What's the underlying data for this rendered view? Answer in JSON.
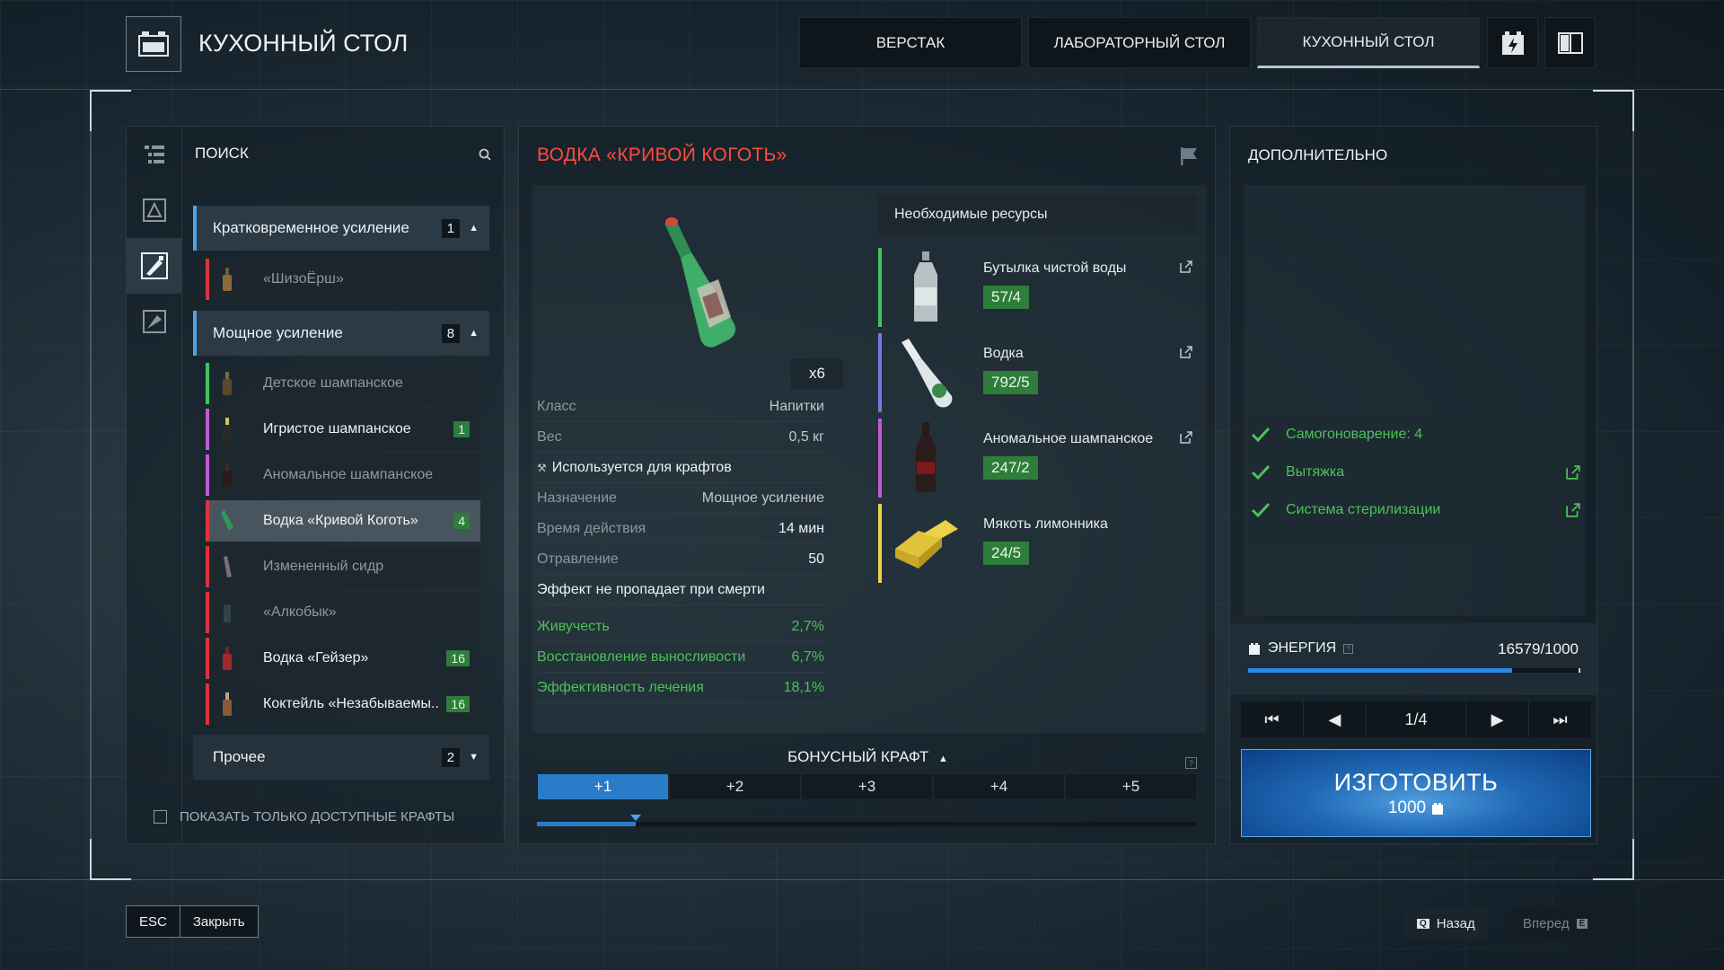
{
  "header": {
    "title": "КУХОННЫЙ СТОЛ",
    "tabs": [
      {
        "label": "ВЕРСТАК"
      },
      {
        "label": "ЛАБОРАТОРНЫЙ СТОЛ"
      },
      {
        "label": "КУХОННЫЙ СТОЛ"
      }
    ],
    "active_tab": 2
  },
  "left": {
    "search_label": "ПОИСК",
    "categories": [
      {
        "label": "Кратковременное усиление",
        "count": "1"
      },
      {
        "label": "Мощное усиление",
        "count": "8"
      },
      {
        "label": "Прочее",
        "count": "2"
      }
    ],
    "items": [
      {
        "label": "«ШизоЁрш»",
        "color": "#d9353d",
        "badge": ""
      },
      {
        "label": "Детское шампанское",
        "color": "#3fc460",
        "badge": ""
      },
      {
        "label": "Игристое шампанское",
        "color": "#c359d4",
        "badge": "1"
      },
      {
        "label": "Аномальное шампанское",
        "color": "#c359d4",
        "badge": ""
      },
      {
        "label": "Водка «Кривой Коготь»",
        "color": "#d9353d",
        "badge": "4"
      },
      {
        "label": "Измененный сидр",
        "color": "#d9353d",
        "badge": ""
      },
      {
        "label": "«Алкобык»",
        "color": "#d9353d",
        "badge": ""
      },
      {
        "label": "Водка «Гейзер»",
        "color": "#d9353d",
        "badge": "16"
      },
      {
        "label": "Коктейль «Незабываемы..",
        "color": "#d9353d",
        "badge": "16"
      }
    ],
    "show_available": "ПОКАЗАТЬ ТОЛЬКО ДОСТУПНЫЕ КРАФТЫ"
  },
  "recipe": {
    "title": "ВОДКА «КРИВОЙ КОГОТЬ»",
    "quantity": "x6",
    "stats": [
      {
        "k": "Класс",
        "v": "Напитки"
      },
      {
        "k": "Вес",
        "v": "0,5 кг"
      }
    ],
    "used_for": "Используется для крафтов",
    "details": [
      {
        "k": "Назначение",
        "v": "Мощное усиление"
      },
      {
        "k": "Время действия",
        "v": "14 мин"
      },
      {
        "k": "Отравление",
        "v": "50"
      }
    ],
    "no_death_loss": "Эффект не пропадает при смерти",
    "effects": [
      {
        "k": "Живучесть",
        "v": "2,7%"
      },
      {
        "k": "Восстановление выносливости",
        "v": "6,7%"
      },
      {
        "k": "Эффективность лечения",
        "v": "18,1%"
      }
    ],
    "resources_title": "Необходимые ресурсы",
    "resources": [
      {
        "name": "Бутылка чистой воды",
        "qty": "57/4",
        "color": "#3fc460",
        "link": true
      },
      {
        "name": "Водка",
        "qty": "792/5",
        "color": "#7a78e0",
        "link": true
      },
      {
        "name": "Аномальное шампанское",
        "qty": "247/2",
        "color": "#c359d4",
        "link": true
      },
      {
        "name": "Мякоть лимонника",
        "qty": "24/5",
        "color": "#e8d44a",
        "link": false
      }
    ],
    "bonus_title": "БОНУСНЫЙ КРАФТ",
    "bonus_tabs": [
      "+1",
      "+2",
      "+3",
      "+4",
      "+5"
    ],
    "bonus_progress": 0.15
  },
  "extra": {
    "title": "ДОПОЛНИТЕЛЬНО",
    "requirements": [
      {
        "label": "Самогоноварение: 4",
        "link": false
      },
      {
        "label": "Вытяжка",
        "link": true
      },
      {
        "label": "Система стерилизации",
        "link": true
      }
    ],
    "energy_label": "ЭНЕРГИЯ",
    "energy_value": "16579/1000",
    "energy_fraction": 0.8,
    "page": "1/4",
    "craft_label": "ИЗГОТОВИТЬ",
    "craft_cost": "1000"
  },
  "footer": {
    "esc": "ESC",
    "close": "Закрыть",
    "back": "Назад",
    "forward": "Вперед"
  },
  "colors": {
    "accent": "#2a7cc8",
    "title_red": "#ff4c3b",
    "green": "#4cc25a"
  }
}
